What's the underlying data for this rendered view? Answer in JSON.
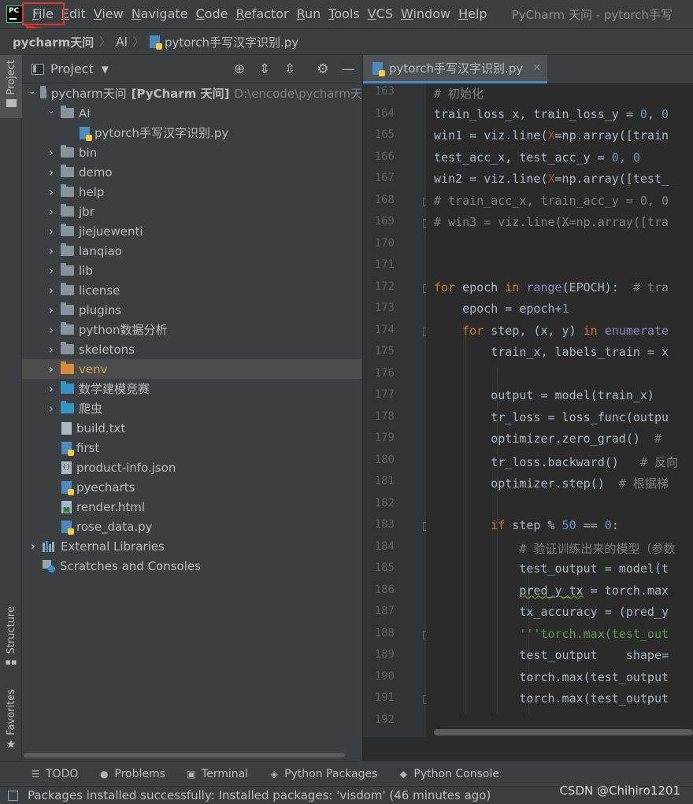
{
  "menubar": {
    "logo_text": "PC",
    "items": [
      {
        "label": "File",
        "ul": "F",
        "rest": "ile"
      },
      {
        "label": "Edit",
        "ul": "E",
        "rest": "dit"
      },
      {
        "label": "View",
        "ul": "V",
        "rest": "iew"
      },
      {
        "label": "Navigate",
        "ul": "N",
        "rest": "avigate"
      },
      {
        "label": "Code",
        "ul": "C",
        "rest": "ode"
      },
      {
        "label": "Refactor",
        "ul": "R",
        "rest": "efactor"
      },
      {
        "label": "Run",
        "ul": "R",
        "rest": "un"
      },
      {
        "label": "Tools",
        "ul": "T",
        "rest": "ools"
      },
      {
        "label": "VCS",
        "ul": "V",
        "rest": "CS"
      },
      {
        "label": "Window",
        "ul": "W",
        "rest": "indow"
      },
      {
        "label": "Help",
        "ul": "H",
        "rest": "elp"
      }
    ],
    "window_title": "PyCharm 天问 - pytorch手写"
  },
  "breadcrumb": [
    "pycharm天问",
    "AI",
    "pytorch手写汉字识别.py"
  ],
  "left_strip": {
    "project": "Project",
    "structure": "Structure",
    "favorites": "Favorites"
  },
  "project_panel": {
    "title": "Project",
    "tree": [
      {
        "label": "pycharm天问",
        "extra": "[PyCharm 天问]",
        "path": "D:\\encode\\pycharm天",
        "type": "folder",
        "arrow": "open",
        "indent": 0
      },
      {
        "label": "AI",
        "type": "folder",
        "arrow": "open",
        "indent": 1
      },
      {
        "label": "pytorch手写汉字识别.py",
        "type": "py",
        "indent": 2
      },
      {
        "label": "bin",
        "type": "folder",
        "arrow": "closed",
        "indent": 1
      },
      {
        "label": "demo",
        "type": "folder",
        "arrow": "closed",
        "indent": 1
      },
      {
        "label": "help",
        "type": "folder",
        "arrow": "closed",
        "indent": 1
      },
      {
        "label": "jbr",
        "type": "folder",
        "arrow": "closed",
        "indent": 1
      },
      {
        "label": "jiejuewenti",
        "type": "folder",
        "arrow": "closed",
        "indent": 1
      },
      {
        "label": "lanqiao",
        "type": "folder",
        "arrow": "closed",
        "indent": 1
      },
      {
        "label": "lib",
        "type": "folder",
        "arrow": "closed",
        "indent": 1
      },
      {
        "label": "license",
        "type": "folder",
        "arrow": "closed",
        "indent": 1
      },
      {
        "label": "plugins",
        "type": "folder",
        "arrow": "closed",
        "indent": 1
      },
      {
        "label": "python数据分析",
        "type": "folder",
        "arrow": "closed",
        "indent": 1
      },
      {
        "label": "skeletons",
        "type": "folder",
        "arrow": "closed",
        "indent": 1
      },
      {
        "label": "venv",
        "type": "folder-orange",
        "arrow": "closed",
        "indent": 1,
        "selected": true
      },
      {
        "label": "数学建模竞赛",
        "type": "folder-blue",
        "arrow": "closed",
        "indent": 1
      },
      {
        "label": "爬虫",
        "type": "folder-blue",
        "arrow": "closed",
        "indent": 1
      },
      {
        "label": "build.txt",
        "type": "file",
        "indent": 1
      },
      {
        "label": "first",
        "type": "py",
        "indent": 1
      },
      {
        "label": "product-info.json",
        "type": "json",
        "indent": 1
      },
      {
        "label": "pyecharts",
        "type": "py",
        "indent": 1
      },
      {
        "label": "render.html",
        "type": "html",
        "indent": 1
      },
      {
        "label": "rose_data.py",
        "type": "py",
        "indent": 1
      },
      {
        "label": "External Libraries",
        "type": "libs",
        "arrow": "closed",
        "indent": 0
      },
      {
        "label": "Scratches and Consoles",
        "type": "scratch",
        "indent": 0
      }
    ]
  },
  "editor": {
    "tab_label": "pytorch手写汉字识别.py",
    "line_numbers": [
      "163",
      "164",
      "165",
      "166",
      "167",
      "168",
      "169",
      "170",
      "171",
      "172",
      "173",
      "174",
      "175",
      "176",
      "177",
      "178",
      "179",
      "180",
      "181",
      "182",
      "183",
      "184",
      "185",
      "186",
      "187",
      "188",
      "189",
      "190",
      "191",
      "192"
    ],
    "lines": [
      "# 初始化",
      "train_loss_x, train_loss_y = 0, 0",
      "win1 = viz.line(X=np.array([train",
      "test_acc_x, test_acc_y = 0, 0",
      "win2 = viz.line(X=np.array([test_",
      "# train_acc_x, train_acc_y = 0, 0",
      "# win3 = viz.line(X=np.array([tra",
      "",
      "",
      "for epoch in range(EPOCH):  # tra",
      "    epoch = epoch+1",
      "    for step, (x, y) in enumerate",
      "        train_x, labels_train = x",
      "",
      "        output = model(train_x)",
      "        tr_loss = loss_func(outpu",
      "        optimizer.zero_grad()  #",
      "        tr_loss.backward()   # 反向",
      "        optimizer.step()  # 根据梯",
      "",
      "        if step % 50 == 0:",
      "            # 验证训练出来的模型（参数",
      "            test_output = model(t",
      "            pred_y_tx = torch.max",
      "            tx_accuracy = (pred_y",
      "            '''torch.max(test_out",
      "            test_output    shape=",
      "            torch.max(test_output",
      "            torch.max(test_output",
      ""
    ]
  },
  "bottom_tools": [
    {
      "icon": "list-icon",
      "label": "TODO"
    },
    {
      "icon": "warning-icon",
      "label": "Problems"
    },
    {
      "icon": "terminal-icon",
      "label": "Terminal"
    },
    {
      "icon": "layers-icon",
      "label": "Python Packages"
    },
    {
      "icon": "python-icon",
      "label": "Python Console"
    }
  ],
  "status": {
    "message": "Packages installed successfully: Installed packages: 'visdom' (46 minutes ago)",
    "watermark": "CSDN @Chihiro1201"
  },
  "colors": {
    "annotation": "#e8312f",
    "accent": "#4a88c7"
  }
}
